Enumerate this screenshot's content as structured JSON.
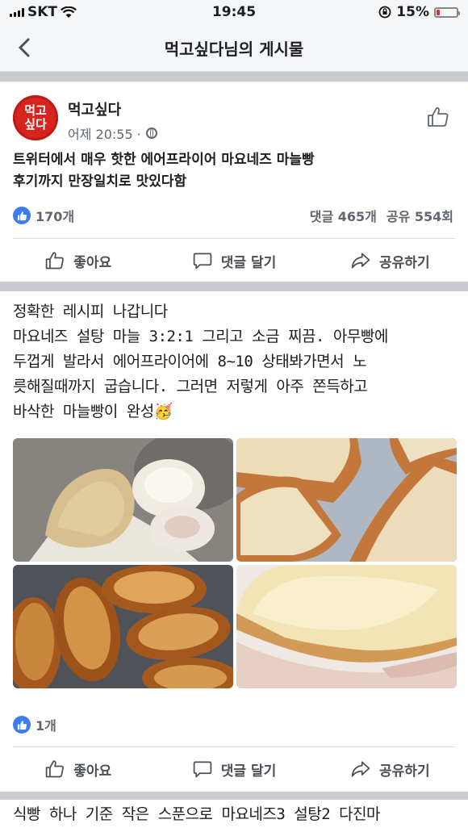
{
  "status": {
    "carrier": "SKT",
    "time": "19:45",
    "battery": "15%",
    "battery_level": 0.15
  },
  "nav": {
    "title": "먹고싶다님의 게시물"
  },
  "post": {
    "avatar_text": [
      "먹고",
      "싶다"
    ],
    "author": "먹고싶다",
    "timestamp": "어제 20:55 ·",
    "text_lines": [
      "트위터에서 매우 핫한 에어프라이어 마요네즈 마늘빵",
      "후기까지 만장일치로 맛있다함"
    ],
    "likes": "170개",
    "comments": "댓글 465개",
    "shares": "공유 554회",
    "actions": {
      "like": "좋아요",
      "comment": "댓글 달기",
      "share": "공유하기"
    }
  },
  "comment": {
    "lines": [
      "정확한 레시피 나갑니다",
      "마요네즈 설탕 마늘 3:2:1 그리고 소금 찌끔. 아무빵에",
      "두껍게 발라서 에어프라이어에 8~10 상태봐가면서 노",
      "릇해질때까지 굽습니다. 그러면 저렇게 아주 쫀득하고",
      "바삭한 마늘빵이 완성🥳"
    ],
    "likes": "1개",
    "actions": {
      "like": "좋아요",
      "comment": "댓글 달기",
      "share": "공유하기"
    }
  },
  "next_comment": {
    "line": "식빵 하나 기준 작은 스푼으로 마요네즈3 설탕2 다진마"
  }
}
